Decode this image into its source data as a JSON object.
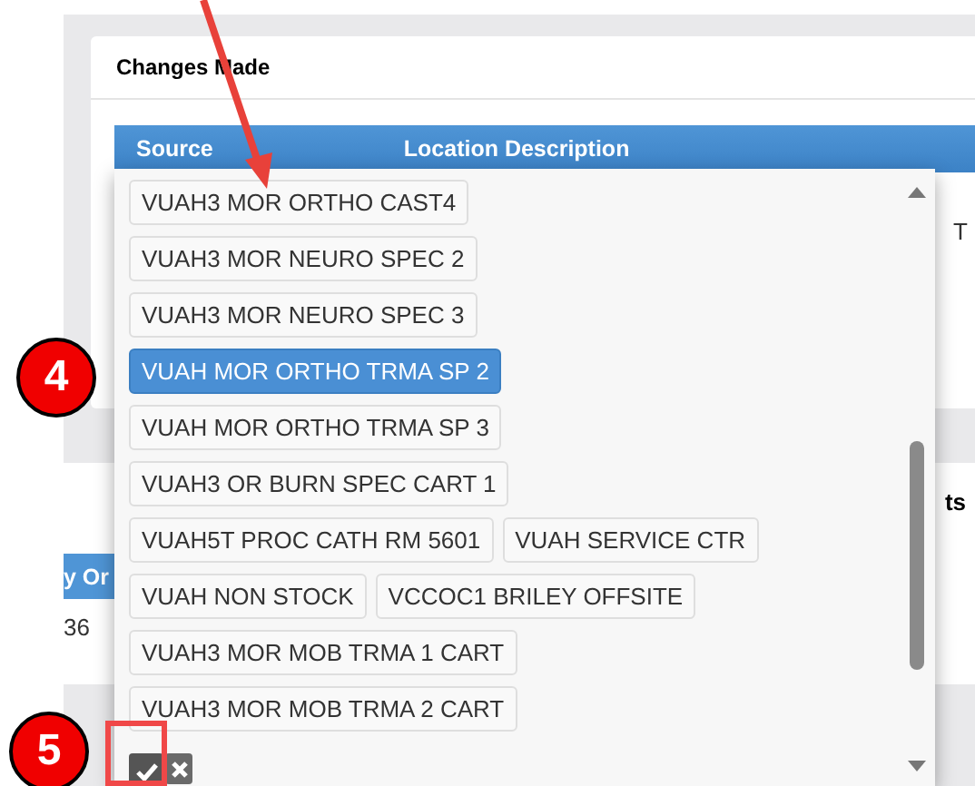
{
  "panel": {
    "title": "Changes Made",
    "columns": [
      "Source",
      "Location Description"
    ],
    "cut_cell": "T"
  },
  "lower_panel": {
    "cut_heading": "ts",
    "cut_column": "y Or",
    "cut_cell": "36"
  },
  "dropdown": {
    "options": [
      {
        "label": "VUAH3 MOR ORTHO CAST4",
        "selected": false
      },
      {
        "label": "VUAH3 MOR NEURO SPEC 2",
        "selected": false
      },
      {
        "label": "VUAH3 MOR NEURO SPEC 3",
        "selected": false
      },
      {
        "label": "VUAH MOR ORTHO TRMA SP 2",
        "selected": true
      },
      {
        "label": "VUAH MOR ORTHO TRMA SP 3",
        "selected": false
      },
      {
        "label": "VUAH3 OR BURN SPEC CART 1",
        "selected": false
      },
      {
        "label": "VUAH5T PROC CATH RM 5601",
        "selected": false
      },
      {
        "label": "VUAH SERVICE CTR",
        "selected": false
      },
      {
        "label": "VUAH NON STOCK",
        "selected": false
      },
      {
        "label": "VCCOC1 BRILEY OFFSITE",
        "selected": false
      },
      {
        "label": "VUAH3 MOR MOB TRMA 1 CART",
        "selected": false
      },
      {
        "label": "VUAH3 MOR MOB TRMA 2 CART",
        "selected": false
      }
    ]
  },
  "callouts": [
    "4",
    "5"
  ]
}
